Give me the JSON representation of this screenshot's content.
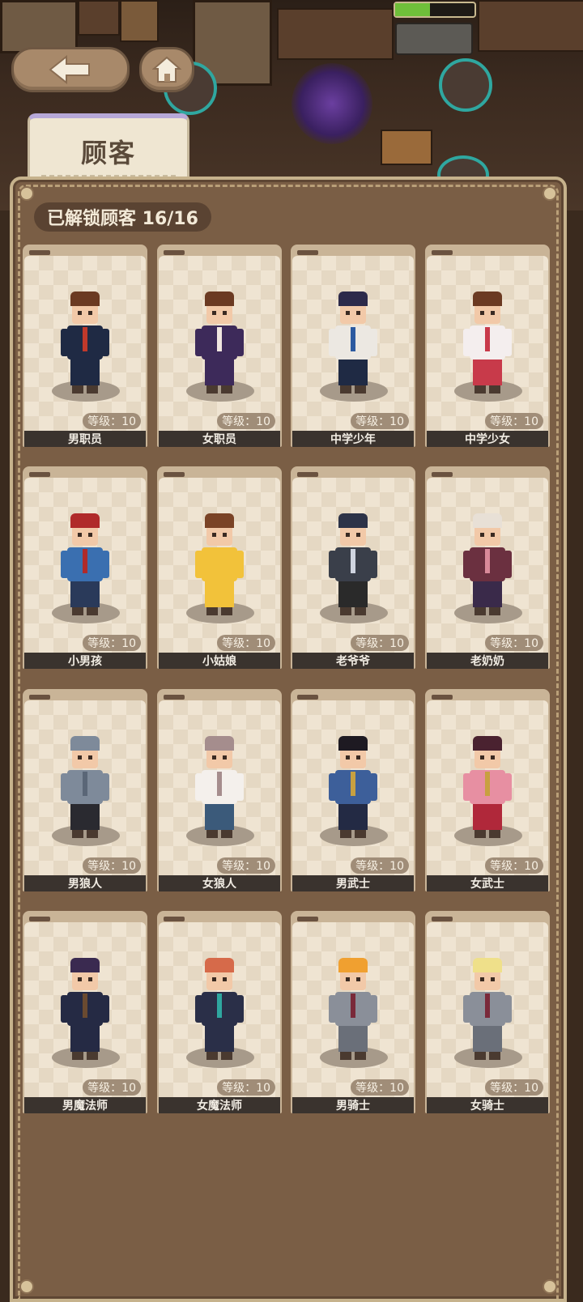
{
  "header": {
    "title": "顾客",
    "back_icon": "arrow-left-icon",
    "home_icon": "home-icon"
  },
  "panel": {
    "unlocked_text": "已解锁顾客 16/16"
  },
  "customers": [
    {
      "name": "男职员",
      "level": "等级：10",
      "hair": "#6b3a22",
      "top": "#1f2a44",
      "bottom": "#1f2a44",
      "accent": "#c0392b"
    },
    {
      "name": "女职员",
      "level": "等级：10",
      "hair": "#6b3a22",
      "top": "#3d2a5a",
      "bottom": "#3d2a5a",
      "accent": "#f0e6e0"
    },
    {
      "name": "中学少年",
      "level": "等级：10",
      "hair": "#2d2a4a",
      "top": "#ece8e2",
      "bottom": "#1f2a44",
      "accent": "#2c5aa0"
    },
    {
      "name": "中学少女",
      "level": "等级：10",
      "hair": "#6b3a22",
      "top": "#f4eeee",
      "bottom": "#c83a4a",
      "accent": "#c83a4a"
    },
    {
      "name": "小男孩",
      "level": "等级：10",
      "hair": "#b02a2a",
      "top": "#3a6fb0",
      "bottom": "#2a3a5a",
      "accent": "#b02a2a"
    },
    {
      "name": "小姑娘",
      "level": "等级：10",
      "hair": "#7a4326",
      "top": "#f2c23a",
      "bottom": "#f2c23a",
      "accent": "#f2c23a"
    },
    {
      "name": "老爷爷",
      "level": "等级：10",
      "hair": "#2d3348",
      "top": "#3a3f4a",
      "bottom": "#2a2a2a",
      "accent": "#cfd4e0"
    },
    {
      "name": "老奶奶",
      "level": "等级：10",
      "hair": "#e8e0d6",
      "top": "#6b3040",
      "bottom": "#3a2a4a",
      "accent": "#d98a9a"
    },
    {
      "name": "男狼人",
      "level": "等级：10",
      "hair": "#7e8a9a",
      "top": "#7e8a9a",
      "bottom": "#2a2a30",
      "accent": "#5a6677"
    },
    {
      "name": "女狼人",
      "level": "等级：10",
      "hair": "#a58d8d",
      "top": "#f4f0ec",
      "bottom": "#3b5a7a",
      "accent": "#a58d8d"
    },
    {
      "name": "男武士",
      "level": "等级：10",
      "hair": "#1e1a22",
      "top": "#3d5f9a",
      "bottom": "#232a44",
      "accent": "#c8a040"
    },
    {
      "name": "女武士",
      "level": "等级：10",
      "hair": "#4a2230",
      "top": "#e78fa2",
      "bottom": "#b0283a",
      "accent": "#c8a040"
    },
    {
      "name": "男魔法师",
      "level": "等级：10",
      "hair": "#3a2a50",
      "top": "#252a44",
      "bottom": "#252a44",
      "accent": "#6a4a30"
    },
    {
      "name": "女魔法师",
      "level": "等级：10",
      "hair": "#d66a4a",
      "top": "#2a2f48",
      "bottom": "#2a2f48",
      "accent": "#2fa7a0"
    },
    {
      "name": "男骑士",
      "level": "等级：10",
      "hair": "#f0a030",
      "top": "#8a8f99",
      "bottom": "#6a6f79",
      "accent": "#7a2a3a"
    },
    {
      "name": "女骑士",
      "level": "等级：10",
      "hair": "#efe08a",
      "top": "#8a8f99",
      "bottom": "#6a6f79",
      "accent": "#7a2a3a"
    }
  ]
}
